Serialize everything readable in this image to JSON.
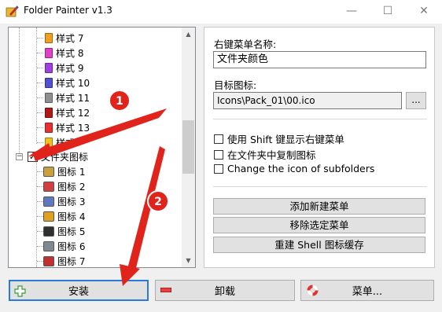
{
  "window": {
    "title": "Folder Painter v1.3",
    "controls": {
      "minimize": "—",
      "maximize": "☐",
      "close": "✕"
    }
  },
  "tree": {
    "style_items": [
      {
        "label": "样式 7",
        "color": "#f0a020"
      },
      {
        "label": "样式 8",
        "color": "#e040c8"
      },
      {
        "label": "样式 9",
        "color": "#a040e0"
      },
      {
        "label": "样式 10",
        "color": "#5050d0"
      },
      {
        "label": "样式 11",
        "color": "#909090"
      },
      {
        "label": "样式 12",
        "color": "#b01818"
      },
      {
        "label": "样式 13",
        "color": "#e83030"
      },
      {
        "label": "样式",
        "color": "#f0c020"
      }
    ],
    "folder_group": {
      "label": "文件夹图标",
      "checked": true,
      "expander": "−"
    },
    "icon_items": [
      {
        "label": "图标 1",
        "color": "#c8a040"
      },
      {
        "label": "图标 2",
        "color": "#d04040"
      },
      {
        "label": "图标 3",
        "color": "#6078c0"
      },
      {
        "label": "图标 4",
        "color": "#e0a020"
      },
      {
        "label": "图标 5",
        "color": "#303030"
      },
      {
        "label": "图标 6",
        "color": "#808890"
      },
      {
        "label": "图标 7",
        "color": "#c03030"
      }
    ],
    "scroll_up": "▲",
    "scroll_down": "▼"
  },
  "settings": {
    "menu_name_label": "右键菜单名称:",
    "menu_name_value": "文件夹颜色",
    "target_icon_label": "目标图标:",
    "target_icon_value": "Icons\\Pack_01\\00.ico",
    "browse_label": "...",
    "options": [
      {
        "label": "使用 Shift 键显示右键菜单",
        "checked": false
      },
      {
        "label": "在文件夹中复制图标",
        "checked": false
      },
      {
        "label": "Change the icon of subfolders",
        "checked": false
      }
    ],
    "actions": {
      "add": "添加新建菜单",
      "remove": "移除选定菜单",
      "rebuild": "重建 Shell 图标缓存"
    }
  },
  "buttons": {
    "install": "安装",
    "uninstall": "卸载",
    "menu": "菜单..."
  },
  "annotations": {
    "step1": "1",
    "step2": "2",
    "accent": "#e0241c"
  }
}
